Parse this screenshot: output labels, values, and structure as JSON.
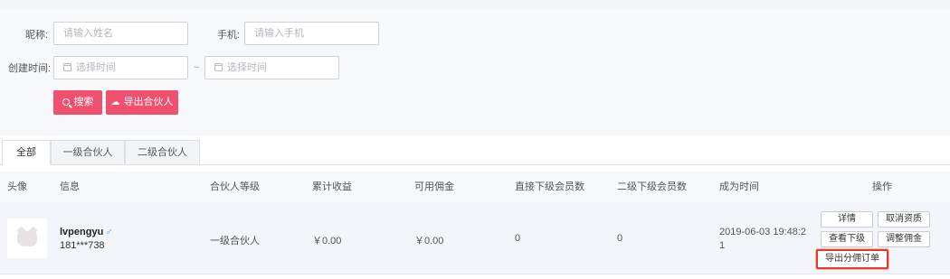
{
  "filters": {
    "nickname_label": "昵称:",
    "nickname_placeholder": "请输入姓名",
    "phone_label": "手机:",
    "phone_placeholder": "请输入手机",
    "created_label": "创建时间:",
    "date_start_placeholder": "选择时间",
    "date_sep": "~",
    "date_end_placeholder": "选择时间",
    "search_label": "搜索",
    "export_label": "导出合伙人"
  },
  "tabs": [
    {
      "label": "全部",
      "active": true
    },
    {
      "label": "一级合伙人",
      "active": false
    },
    {
      "label": "二级合伙人",
      "active": false
    }
  ],
  "table": {
    "headers": [
      "头像",
      "信息",
      "合伙人等级",
      "累计收益",
      "可用佣金",
      "直接下级会员数",
      "二级下级会员数",
      "成为时间",
      "操作"
    ],
    "rows": [
      {
        "name": "lvpengyu",
        "gender_icon": "male-icon",
        "phone": "181***738",
        "level": "一级合伙人",
        "total_income": "￥0.00",
        "available_commission": "￥0.00",
        "direct_members": "0",
        "second_members": "0",
        "join_time_line1": "2019-06-03 19:48:2",
        "join_time_line2": "1",
        "actions": {
          "detail": "详情",
          "cancel": "取消资质",
          "view_sub": "查看下级",
          "adjust": "调整佣金",
          "export_orders": "导出分佣订单"
        }
      }
    ]
  },
  "colors": {
    "accent": "#f0506e",
    "highlight_border": "#e23b2e"
  }
}
